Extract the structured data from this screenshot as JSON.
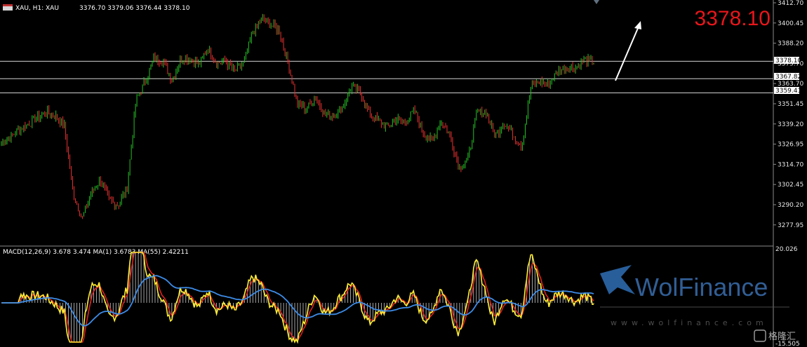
{
  "header": {
    "symbol": "XAU, H1:  XAU",
    "ohlc": "3376.70 3379.06 3376.44 3378.10"
  },
  "big_price": "3378.10",
  "price_axis": {
    "ticks": [
      "3412.70",
      "3400.45",
      "3388.20",
      "3375.70",
      "3363.70",
      "3351.45",
      "3339.20",
      "3326.95",
      "3314.70",
      "3302.45",
      "3290.20",
      "3277.95"
    ],
    "current": "3378.10",
    "levels": [
      "3367.82",
      "3359.41"
    ]
  },
  "macd_panel": {
    "label": "MACD(12,26,9) 3.678 3.474 MA(1) 3.6783 MA(55) 2.42211",
    "ticks": [
      "20.026",
      "-15.505"
    ]
  },
  "watermark": {
    "brand": "WolFinance",
    "site": "www.wolfinance.com",
    "corner": "格隆汇"
  },
  "chart_data": [
    {
      "type": "candlestick",
      "title": "XAU, H1",
      "ylim": [
        3270.0,
        3412.7
      ],
      "horizontal_levels": [
        3378.1,
        3367.82,
        3359.41
      ],
      "close_path": [
        3330,
        3333,
        3338,
        3341,
        3345,
        3348,
        3346,
        3340,
        3300,
        3285,
        3300,
        3308,
        3296,
        3293,
        3303,
        3355,
        3366,
        3380,
        3378,
        3367,
        3380,
        3380,
        3376,
        3386,
        3377,
        3378,
        3372,
        3377,
        3395,
        3403,
        3400,
        3396,
        3375,
        3353,
        3350,
        3357,
        3347,
        3346,
        3351,
        3363,
        3360,
        3347,
        3343,
        3339,
        3344,
        3342,
        3349,
        3336,
        3331,
        3343,
        3334,
        3315,
        3320,
        3348,
        3348,
        3334,
        3342,
        3335,
        3328,
        3363,
        3366,
        3365,
        3372,
        3375,
        3374,
        3379,
        3378
      ],
      "annotation": "up-arrow"
    },
    {
      "type": "line",
      "title": "MACD(12,26,9)",
      "ylim": [
        -15.505,
        20.026
      ],
      "series": [
        {
          "name": "MACD",
          "values": [
            3.678
          ]
        },
        {
          "name": "MA(1)",
          "values": [
            3.6783
          ]
        },
        {
          "name": "MA(55)",
          "values": [
            2.42211
          ]
        }
      ]
    }
  ]
}
